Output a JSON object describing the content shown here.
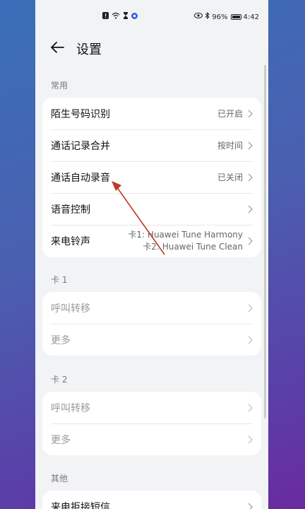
{
  "status": {
    "battery": "96%",
    "time": "4:42"
  },
  "header": {
    "title": "设置"
  },
  "sections": {
    "common": {
      "label": "常用",
      "rows": [
        {
          "label": "陌生号码识别",
          "value": "已开启"
        },
        {
          "label": "通话记录合并",
          "value": "按时间"
        },
        {
          "label": "通话自动录音",
          "value": "已关闭"
        },
        {
          "label": "语音控制",
          "value": ""
        },
        {
          "label": "来电铃声",
          "value_line1": "卡1: Huawei Tune Harmony",
          "value_line2": "卡2: Huawei Tune Clean"
        }
      ]
    },
    "card1": {
      "label": "卡 1",
      "rows": [
        {
          "label": "呼叫转移"
        },
        {
          "label": "更多"
        }
      ]
    },
    "card2": {
      "label": "卡 2",
      "rows": [
        {
          "label": "呼叫转移"
        },
        {
          "label": "更多"
        }
      ]
    },
    "other": {
      "label": "其他",
      "rows": [
        {
          "label": "来电拒接短信"
        }
      ]
    }
  },
  "colors": {
    "annotation_arrow": "#c0392b"
  }
}
